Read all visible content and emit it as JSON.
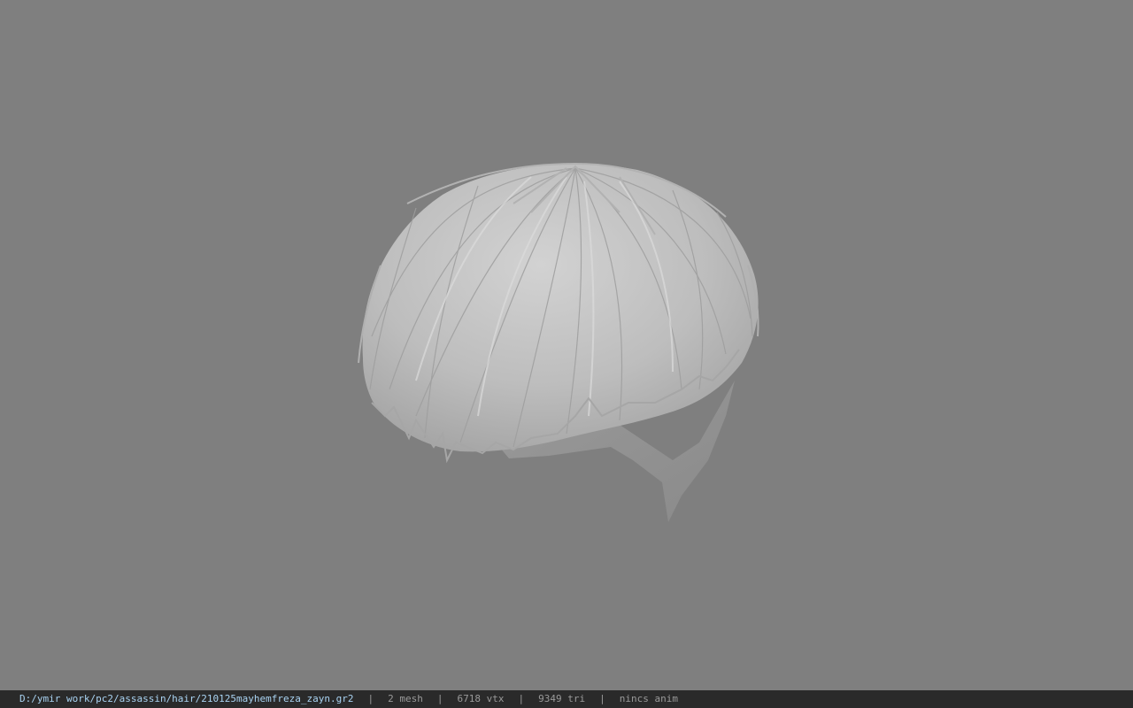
{
  "viewport": {
    "background_color": "#7f7f7f",
    "model_color": "#c4c4c4",
    "model_shadow_color": "#8e8e8e"
  },
  "status_bar": {
    "file_path": "D:/ymir work/pc2/assassin/hair/210125mayhemfreza_zayn.gr2",
    "separator": "|",
    "mesh_count": "2 mesh",
    "vertex_count": "6718 vtx",
    "triangle_count": "9349 tri",
    "animation_status": "nincs anim",
    "path_color": "#a9d3f2",
    "text_color": "#9a9a9a"
  }
}
